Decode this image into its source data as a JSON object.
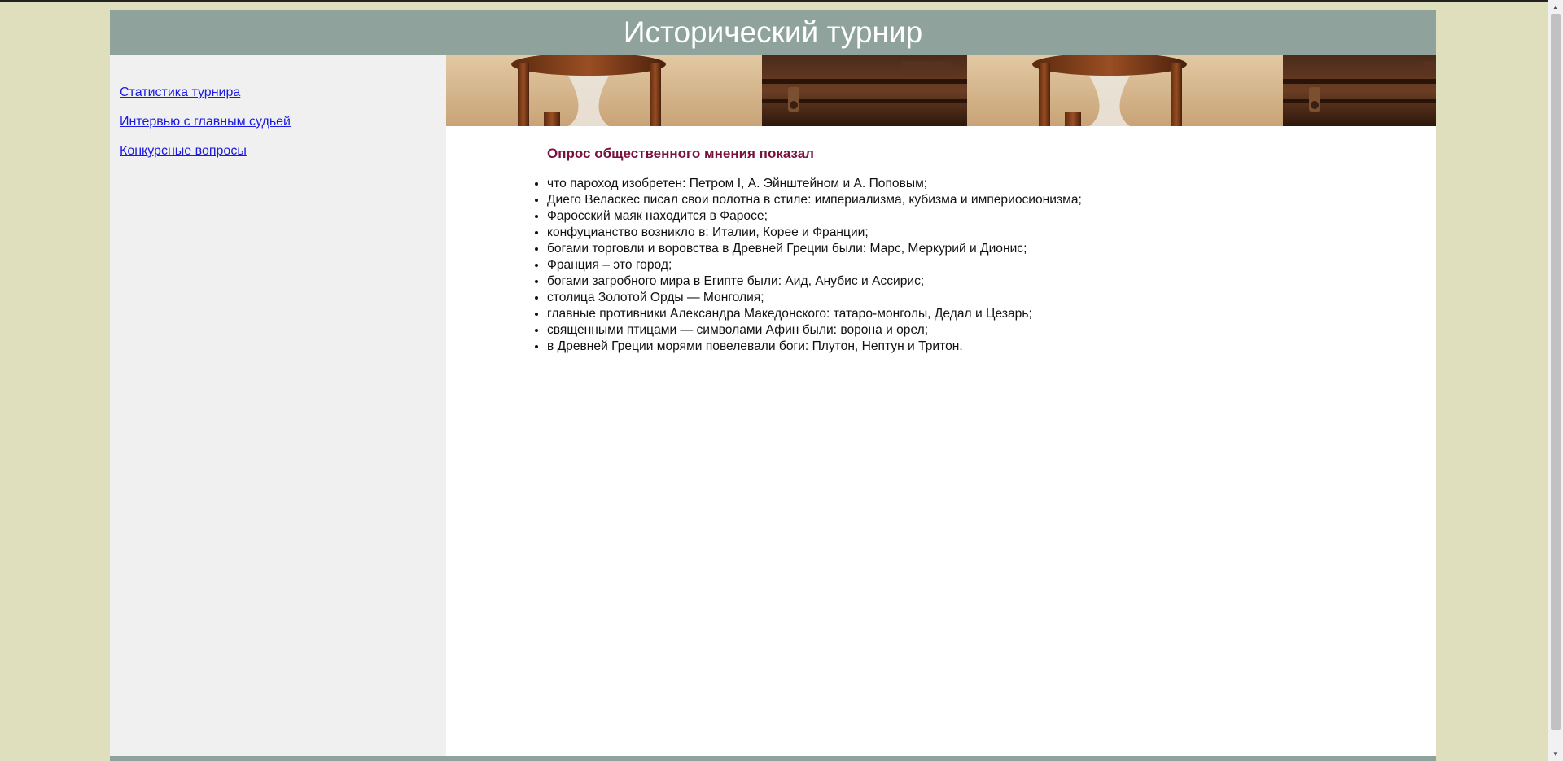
{
  "header": {
    "title": "Исторический турнир"
  },
  "sidebar": {
    "items": [
      {
        "label": "Статистика турнира"
      },
      {
        "label": "Интервью с главным судьей"
      },
      {
        "label": "Конкурсные вопросы"
      }
    ]
  },
  "main": {
    "heading": "Опрос общественного мнения показал",
    "facts": [
      "что пароход изобретен: Петром I, А. Эйнштейном и А. Поповым;",
      "Диего Веласкес писал свои полотна в стиле: империализма, кубизма и империосионизма;",
      "Фаросский маяк находится в Фаросе;",
      "конфуцианство возникло в: Италии, Корее и Франции;",
      "богами торговли и воровства в Древней Греции были: Марс, Меркурий и Дионис;",
      "Франция – это город;",
      "богами загробного мира в Египте были: Аид, Анубис и Ассирис;",
      "столица Золотой Орды — Монголия;",
      "главные противники Александра Македонского: татаро-монголы, Дедал и Цезарь;",
      "священными птицами — символами Афин были: ворона и орел;",
      "в Древней Греции морями повелевали боги: Плутон, Нептун и Тритон."
    ]
  },
  "colors": {
    "page_background": "#e0dfbd",
    "header_background": "#8fa29b",
    "sidebar_background": "#f0f0f0",
    "heading_color": "#7a1040",
    "link_color": "#1a1ae0"
  },
  "banner": {
    "image": "hourglass-and-chest-banner"
  }
}
